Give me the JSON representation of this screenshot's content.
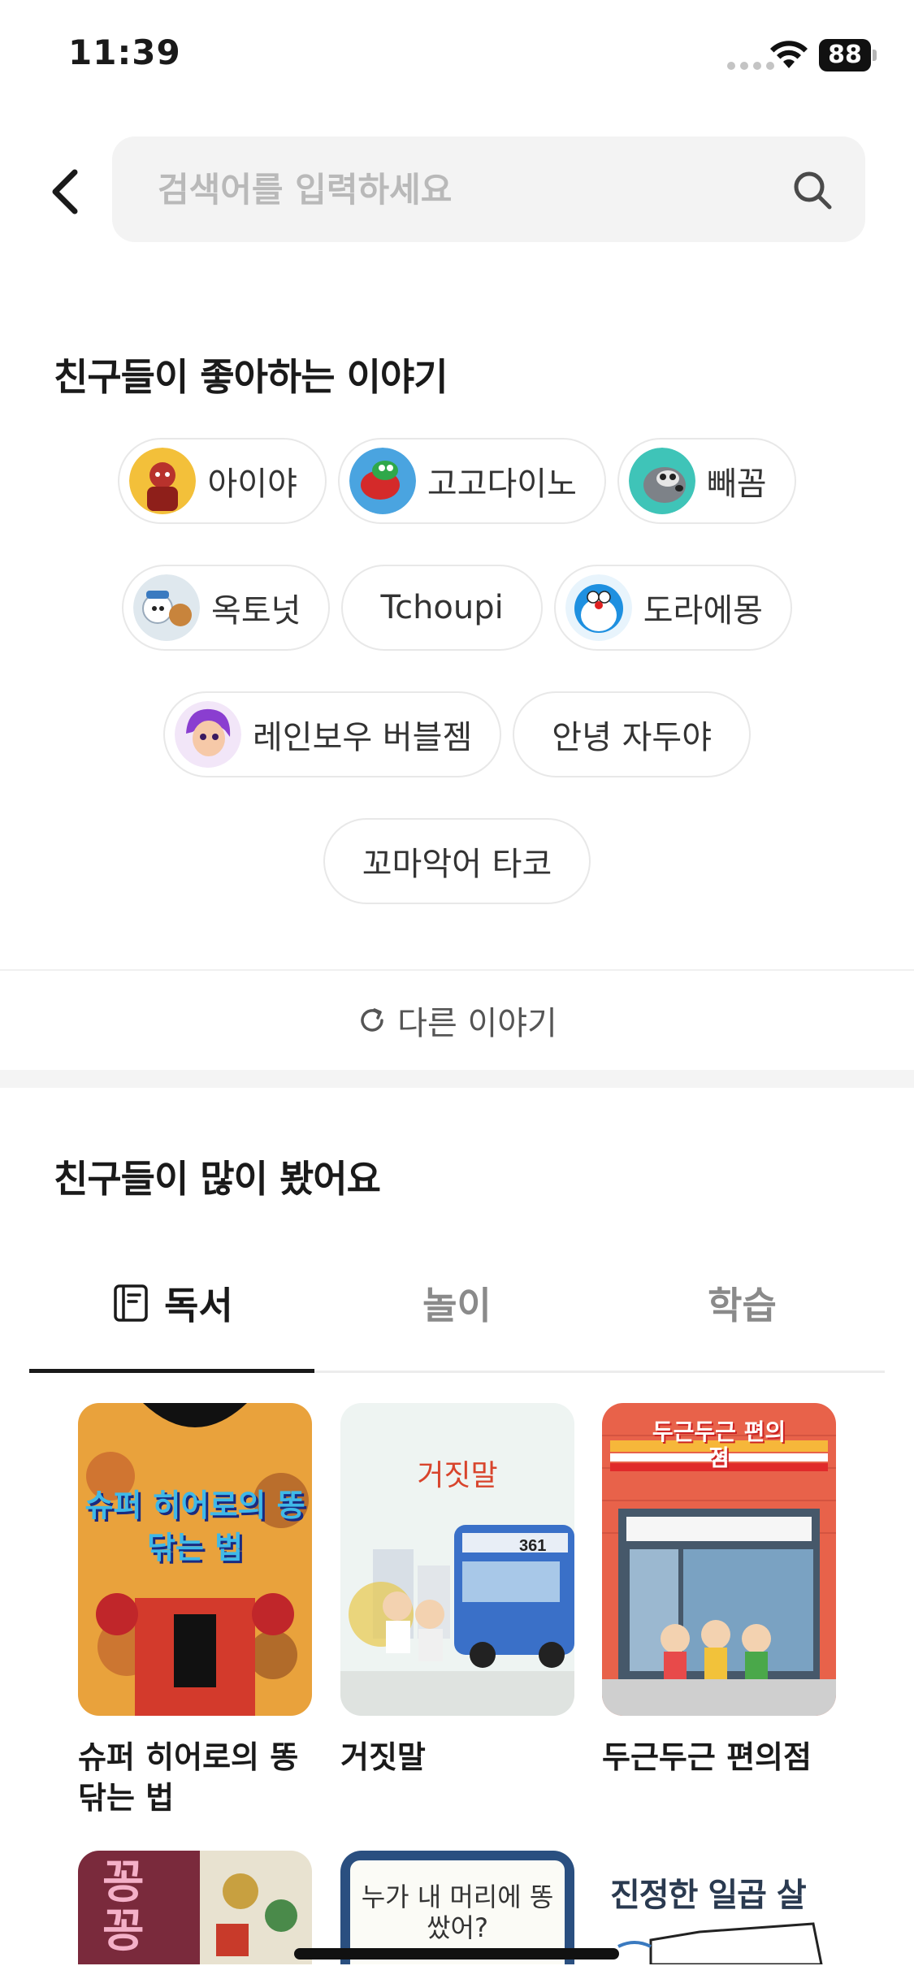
{
  "status": {
    "time": "11:39",
    "battery": "88"
  },
  "search": {
    "placeholder": "검색어를 입력하세요"
  },
  "popular_stories": {
    "title": "친구들이 좋아하는 이야기",
    "chips": [
      {
        "label": "아이야",
        "avatar": true,
        "avatar_color": "#b8322c"
      },
      {
        "label": "고고다이노",
        "avatar": true,
        "avatar_color": "#1f8f3a"
      },
      {
        "label": "빼꼼",
        "avatar": true,
        "avatar_color": "#6b6f74"
      },
      {
        "label": "옥토넛",
        "avatar": true,
        "avatar_color": "#f0f0f0"
      },
      {
        "label": "Tchoupi",
        "avatar": false
      },
      {
        "label": "도라에몽",
        "avatar": true,
        "avatar_color": "#1e90e0"
      },
      {
        "label": "레인보우 버블젬",
        "avatar": true,
        "avatar_color": "#9b4dd8"
      },
      {
        "label": "안녕 자두야",
        "avatar": false
      },
      {
        "label": "꼬마악어 타코",
        "avatar": false
      }
    ],
    "refresh_label": "다른 이야기"
  },
  "most_viewed": {
    "title": "친구들이 많이 봤어요",
    "tabs": [
      {
        "label": "독서",
        "icon": "book-icon",
        "active": true
      },
      {
        "label": "놀이",
        "active": false
      },
      {
        "label": "학습",
        "active": false
      }
    ],
    "books": [
      {
        "title": "슈퍼 히어로의 똥 닦는 법",
        "cover_text": "슈퍼 히어로의 똥 닦는 법",
        "cover_color": "#c9362c"
      },
      {
        "title": "거짓말",
        "cover_text": "거짓말",
        "cover_color": "#eef4f2"
      },
      {
        "title": "두근두근 편의점",
        "cover_text": "두근두근 편의점",
        "cover_color": "#e8624a"
      }
    ],
    "books_row2": [
      {
        "cover_text": "꽁꽁",
        "cover_color": "#7a2a3c"
      },
      {
        "cover_text": "누가 내 머리에 똥 쌌어?",
        "cover_color": "#2a4f80"
      },
      {
        "cover_text": "진정한 일곱 살",
        "cover_color": "#ffffff"
      }
    ]
  }
}
